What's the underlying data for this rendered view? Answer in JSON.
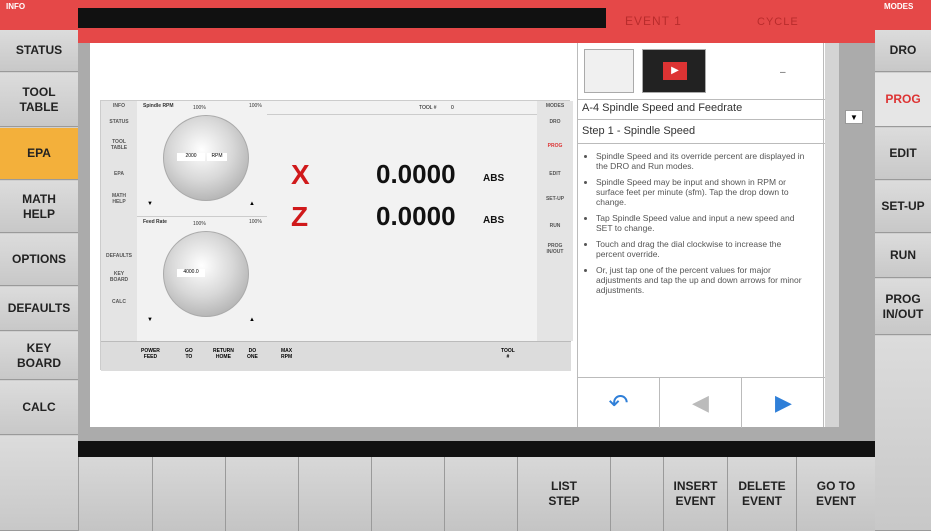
{
  "topbar": {
    "info": "INFO",
    "modes": "MODES",
    "event": "EVENT 1",
    "cycle": "CYCLE"
  },
  "left_menu": [
    "STATUS",
    "TOOL\nTABLE",
    "EPA",
    "MATH\nHELP",
    "OPTIONS",
    "DEFAULTS",
    "KEY\nBOARD",
    "CALC"
  ],
  "right_menu": [
    "DRO",
    "PROG",
    "EDIT",
    "SET-UP",
    "RUN",
    "PROG\nIN/OUT"
  ],
  "bottom_menu": [
    "",
    "",
    "",
    "",
    "",
    "",
    "LIST\nSTEP",
    "",
    "INSERT\nEVENT",
    "DELETE\nEVENT",
    "GO TO\nEVENT"
  ],
  "dro": {
    "x_label": "X",
    "x_value": "0.0000",
    "x_unit": "ABS",
    "z_label": "Z",
    "z_value": "0.0000",
    "z_unit": "ABS"
  },
  "mini": {
    "spindle_label": "Spindle RPM",
    "spindle_pct": "100%",
    "spindle_max": "100%",
    "spindle_value": "2000",
    "spindle_unit": "RPM",
    "feed_label": "Feed Rate",
    "feed_pct": "100%",
    "feed_max": "100%",
    "feed_value": "4000.0",
    "tool_label": "TOOL #",
    "tool_value": "0",
    "left": [
      "INFO",
      "STATUS",
      "TOOL\nTABLE",
      "EPA",
      "MATH\nHELP",
      "DEFAULTS",
      "KEY\nBOARD",
      "CALC"
    ],
    "right": [
      "MODES",
      "DRO",
      "PROG",
      "EDIT",
      "SET-UP",
      "RUN",
      "PROG\nIN/OUT"
    ],
    "bottom": [
      "POWER\nFEED",
      "GO\nTO",
      "RETURN\nHOME",
      "DO\nONE",
      "MAX\nRPM",
      "TOOL\n#"
    ]
  },
  "help": {
    "title": "A-4 Spindle Speed and Feedrate",
    "step": "Step 1 - Spindle Speed",
    "bullets": [
      "Spindle Speed and its override percent are displayed in the DRO and Run modes.",
      "Spindle Speed may be input and shown in RPM or surface feet per minute (sfm). Tap the drop down to change.",
      "Tap Spindle Speed value and input a new speed and SET to change.",
      "Touch and drag the dial clockwise to increase the percent override.",
      "Or, just tap one of the percent values for major adjustments and tap the up and down arrows for minor adjustments."
    ]
  },
  "colors": {
    "accent_red": "#e54848",
    "epa_active": "#f3b03b",
    "prog_active": "#d33333",
    "axis_red": "#d0191b",
    "nav_blue": "#2f7fd8"
  },
  "icons": [
    "back-arrow-icon",
    "left-arrow-icon",
    "right-arrow-icon",
    "dropdown-icon"
  ]
}
